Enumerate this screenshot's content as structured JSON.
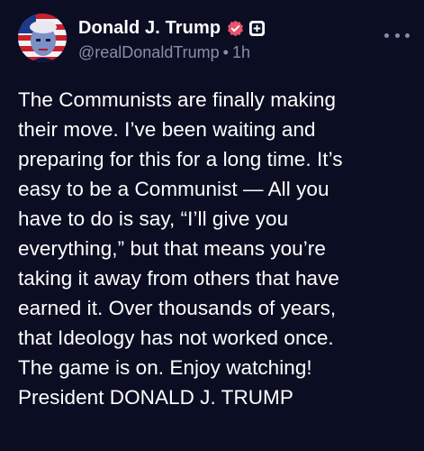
{
  "author": {
    "display_name": "Donald J. Trump",
    "handle": "@realDonaldTrump",
    "separator": "•",
    "time": "1h",
    "avatar_icon": "avatar-portrait-flag",
    "verified_icon": "verified-badge-icon",
    "verified_color": "#e9546b",
    "badge_icon": "plus-badge-icon"
  },
  "menu": {
    "icon": "more-horizontal-icon"
  },
  "post": {
    "text": "The Communists are finally making\ntheir move. I’ve been waiting and\npreparing for this for a long time. It’s\neasy to be a Communist — All you\nhave to do is say, “I’ll give you\neverything,” but that means you’re\ntaking it away from others that have\nearned it. Over thousands of years,\nthat Ideology has not worked once.\nThe game is on. Enjoy watching!\nPresident DONALD J. TRUMP"
  },
  "colors": {
    "background": "#0b0d22",
    "text": "#ffffff",
    "muted": "#8a8ea8"
  }
}
